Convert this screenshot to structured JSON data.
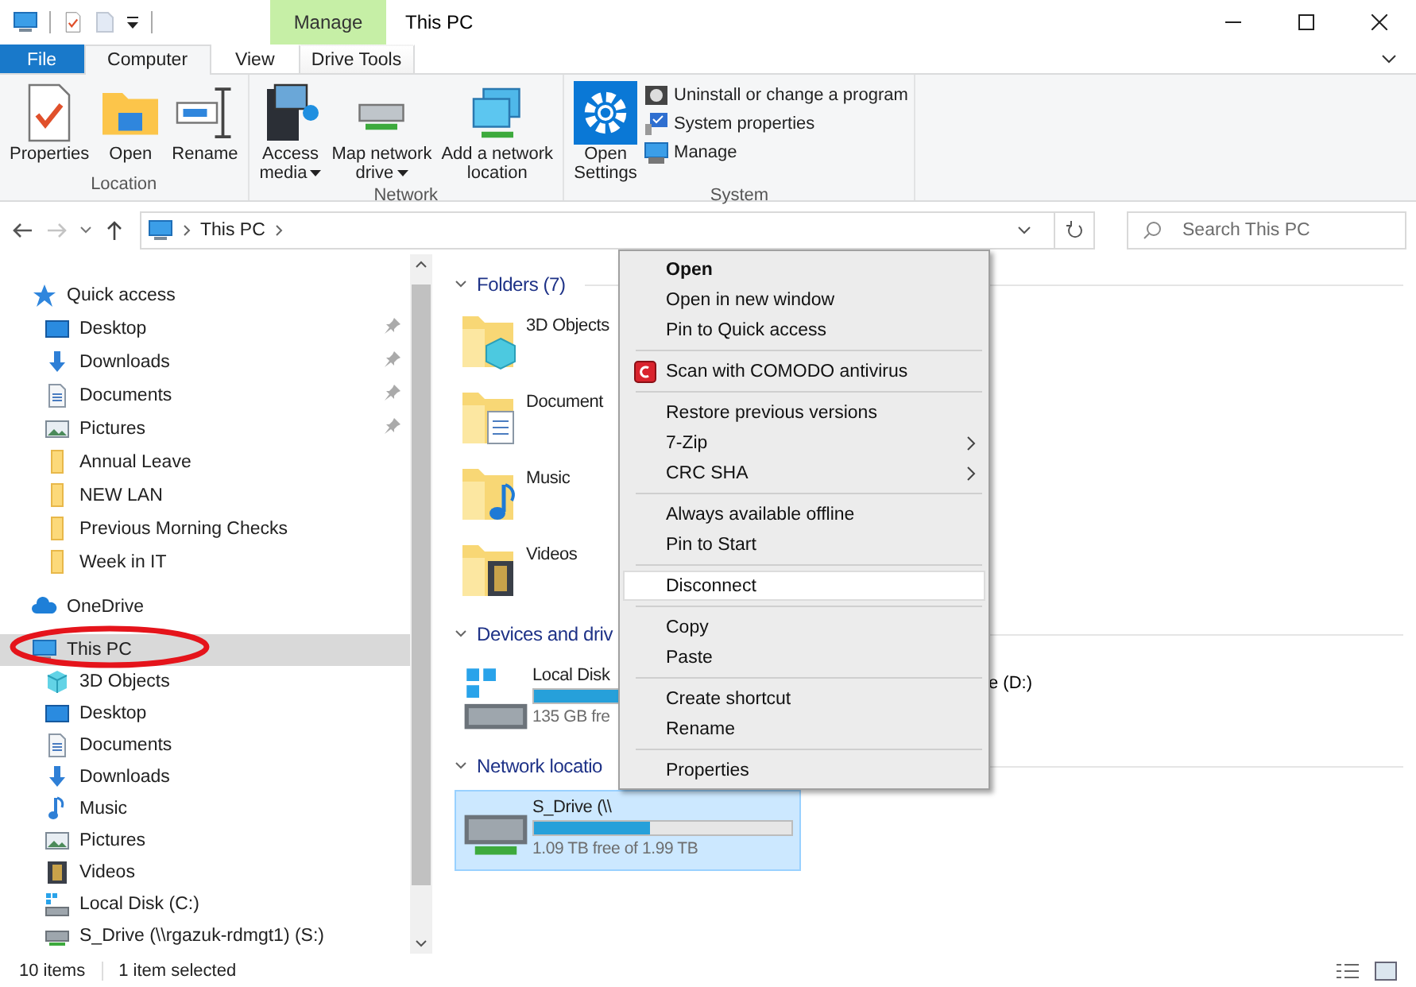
{
  "title_bar": {
    "context_header": "Manage",
    "title": "This PC"
  },
  "ribbon": {
    "tabs": [
      {
        "label": "File",
        "kind": "file",
        "selected": false
      },
      {
        "label": "Computer",
        "kind": "normal",
        "selected": true
      },
      {
        "label": "View",
        "kind": "normal",
        "selected": false
      },
      {
        "label": "Drive Tools",
        "kind": "context",
        "selected": false
      }
    ],
    "groups": [
      {
        "label": "Location",
        "buttons": [
          {
            "lines": [
              "Properties"
            ],
            "kind": "properties",
            "dropdown": false
          },
          {
            "lines": [
              "Open"
            ],
            "kind": "open",
            "dropdown": false
          },
          {
            "lines": [
              "Rename"
            ],
            "kind": "rename",
            "dropdown": false
          }
        ]
      },
      {
        "label": "Network",
        "buttons": [
          {
            "lines": [
              "Access",
              "media"
            ],
            "kind": "media",
            "dropdown": true
          },
          {
            "lines": [
              "Map network",
              "drive"
            ],
            "kind": "netdrive",
            "dropdown": true
          },
          {
            "lines": [
              "Add a network",
              "location"
            ],
            "kind": "netloc",
            "dropdown": false
          }
        ]
      },
      {
        "label": "System",
        "buttons": [
          {
            "lines": [
              "Open",
              "Settings"
            ],
            "kind": "settings",
            "dropdown": false
          }
        ],
        "small_buttons": [
          {
            "label": "Uninstall or change a program",
            "kind": "uninstall"
          },
          {
            "label": "System properties",
            "kind": "sysprops"
          },
          {
            "label": "Manage",
            "kind": "manage"
          }
        ]
      }
    ]
  },
  "nav": {
    "back": {
      "disabled": false
    },
    "forward": {
      "disabled": true
    }
  },
  "address_bar": {
    "path": [
      "This PC"
    ],
    "search": {
      "placeholder": "Search This PC"
    }
  },
  "sidebar": {
    "items": [
      {
        "label": "Quick access",
        "kind": "star",
        "selected": false,
        "children": [
          {
            "label": "Desktop",
            "kind": "desktop",
            "selected": false,
            "pinned": true
          },
          {
            "label": "Downloads",
            "kind": "downloads",
            "selected": false,
            "pinned": true
          },
          {
            "label": "Documents",
            "kind": "documents",
            "selected": false,
            "pinned": true
          },
          {
            "label": "Pictures",
            "kind": "pictures",
            "selected": false,
            "pinned": true
          },
          {
            "label": "Annual Leave",
            "kind": "folder",
            "selected": false,
            "pinned": false
          },
          {
            "label": "NEW LAN",
            "kind": "folder",
            "selected": false,
            "pinned": false
          },
          {
            "label": "Previous Morning Checks",
            "kind": "folder",
            "selected": false,
            "pinned": false
          },
          {
            "label": "Week in IT",
            "kind": "folder",
            "selected": false,
            "pinned": false
          }
        ]
      },
      {
        "label": "OneDrive",
        "kind": "cloud",
        "selected": false
      },
      {
        "label": "This PC",
        "kind": "pc",
        "selected": true,
        "children": [
          {
            "label": "3D Objects",
            "kind": "cube",
            "selected": false,
            "pinned": false
          },
          {
            "label": "Desktop",
            "kind": "desktop",
            "selected": false,
            "pinned": false
          },
          {
            "label": "Documents",
            "kind": "documents",
            "selected": false,
            "pinned": false
          },
          {
            "label": "Downloads",
            "kind": "downloads",
            "selected": false,
            "pinned": false
          },
          {
            "label": "Music",
            "kind": "music",
            "selected": false,
            "pinned": false
          },
          {
            "label": "Pictures",
            "kind": "pictures",
            "selected": false,
            "pinned": false
          },
          {
            "label": "Videos",
            "kind": "videos",
            "selected": false,
            "pinned": false
          },
          {
            "label": "Local Disk (C:)",
            "kind": "disk",
            "selected": false,
            "pinned": false
          },
          {
            "label": "S_Drive (\\\\rgazuk-rdmgt1) (S:)",
            "kind": "netdisk",
            "selected": false,
            "pinned": false
          }
        ]
      }
    ]
  },
  "content": {
    "sections": [
      {
        "title": "Folders (7)",
        "kind": "folders",
        "items": [
          {
            "label": "3D Objects",
            "kind": "cube"
          },
          {
            "label": "Document",
            "kind": "documents"
          },
          {
            "label": "Music",
            "kind": "music"
          },
          {
            "label": "Videos",
            "kind": "videos"
          }
        ]
      },
      {
        "title": "Devices and driv",
        "kind": "drives",
        "items": [
          {
            "label": "Local Disk",
            "kind": "disk",
            "free": "135 GB fre",
            "level": 0.75,
            "selected": false
          },
          {
            "label": "e (D:)",
            "kind": "covered"
          }
        ]
      },
      {
        "title": "Network locatio",
        "kind": "drives",
        "items": [
          {
            "label": "S_Drive (\\\\",
            "kind": "netdisk",
            "free": "1.09 TB free of 1.99 TB",
            "level": 0.45,
            "selected": true
          }
        ]
      }
    ]
  },
  "context_menu": {
    "groups": [
      [
        {
          "label": "Open",
          "kind": "default",
          "selected": false
        },
        {
          "label": "Open in new window",
          "kind": "plain",
          "selected": false
        },
        {
          "label": "Pin to Quick access",
          "kind": "plain",
          "selected": false
        }
      ],
      [
        {
          "label": "Scan with COMODO antivirus",
          "kind": "app",
          "selected": false
        }
      ],
      [
        {
          "label": "Restore previous versions",
          "kind": "plain",
          "selected": false
        },
        {
          "label": "7-Zip",
          "kind": "submenu",
          "selected": false
        },
        {
          "label": "CRC SHA",
          "kind": "submenu",
          "selected": false
        }
      ],
      [
        {
          "label": "Always available offline",
          "kind": "plain",
          "selected": false
        },
        {
          "label": "Pin to Start",
          "kind": "plain",
          "selected": false
        }
      ],
      [
        {
          "label": "Disconnect",
          "kind": "plain",
          "selected": true
        }
      ],
      [
        {
          "label": "Copy",
          "kind": "plain",
          "selected": false
        },
        {
          "label": "Paste",
          "kind": "plain",
          "selected": false
        }
      ],
      [
        {
          "label": "Create shortcut",
          "kind": "plain",
          "selected": false
        },
        {
          "label": "Rename",
          "kind": "plain",
          "selected": false
        }
      ],
      [
        {
          "label": "Properties",
          "kind": "plain",
          "selected": false
        }
      ]
    ]
  },
  "status_bar": {
    "count": "10 items",
    "selection": "1 item selected"
  }
}
